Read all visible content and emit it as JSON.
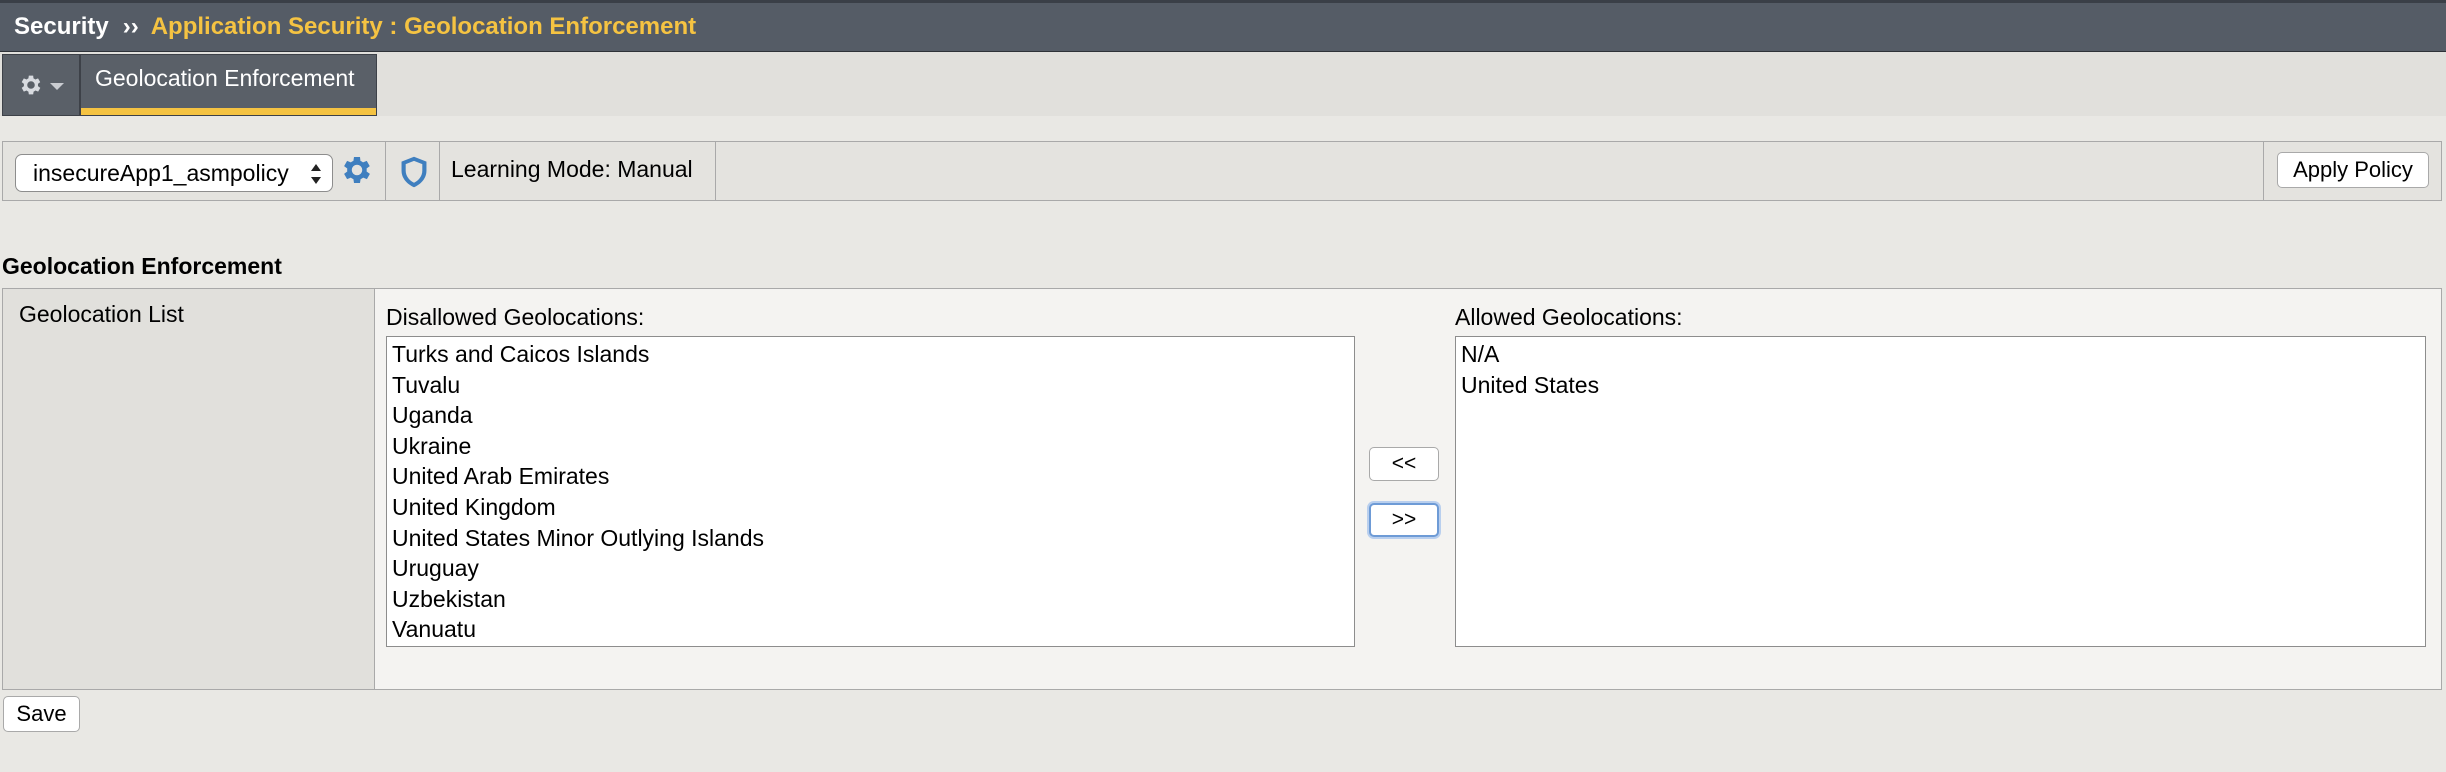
{
  "breadcrumb": {
    "root": "Security",
    "separator": "››",
    "current": "Application Security : Geolocation Enforcement"
  },
  "tabbar": {
    "menu_icon": "gear-icon",
    "active_tab": "Geolocation Enforcement"
  },
  "toolbar": {
    "policy_selected": "insecureApp1_asmpolicy",
    "settings_icon": "gear-icon",
    "shield_icon": "shield-icon",
    "learning_mode": "Learning Mode: Manual",
    "apply_label": "Apply Policy"
  },
  "section": {
    "title": "Geolocation Enforcement",
    "row_label": "Geolocation List",
    "disallowed_label": "Disallowed Geolocations:",
    "disallowed": [
      "Turks and Caicos Islands",
      "Tuvalu",
      "Uganda",
      "Ukraine",
      "United Arab Emirates",
      "United Kingdom",
      "United States Minor Outlying Islands",
      "Uruguay",
      "Uzbekistan",
      "Vanuatu"
    ],
    "allowed_label": "Allowed Geolocations:",
    "allowed": [
      "N/A",
      "United States"
    ],
    "move_left": "<<",
    "move_right": ">>"
  },
  "save_label": "Save",
  "colors": {
    "header_bg": "#555c66",
    "accent_yellow": "#f5c342",
    "focus_blue": "#6e9bd6",
    "gear_blue": "#3f7fbf"
  }
}
